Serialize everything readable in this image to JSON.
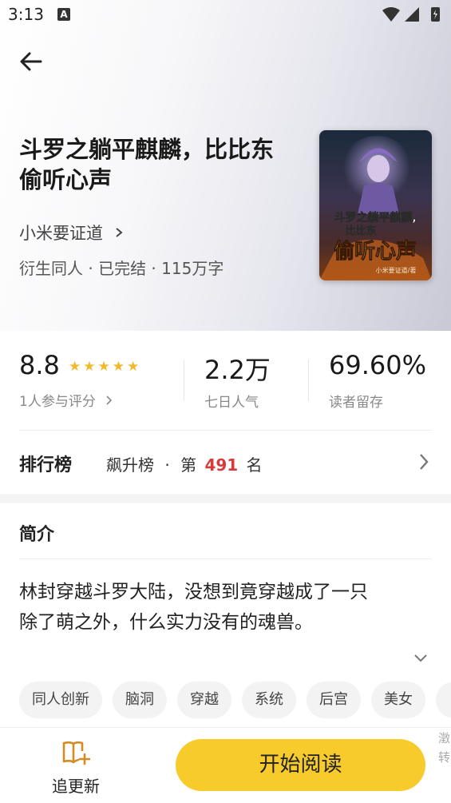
{
  "status_bar": {
    "time": "3:13",
    "notification_icon_letter": "A",
    "icons": [
      "wifi-icon",
      "signal-icon",
      "battery-icon"
    ]
  },
  "book": {
    "title_line1": "斗罗之躺平麒麟，比比东",
    "title_line2": "偷听心声",
    "author": "小米要证道",
    "meta": "衍生同人 · 已完结 · 115万字",
    "cover": {
      "line1": "斗罗之躺平麒麟,",
      "line2": "比比东",
      "line3": "偷听心声",
      "byline": "小米要证道/著"
    }
  },
  "stats": {
    "score": "8.8",
    "stars": "★★★★★",
    "rating_count_label": "1人参与评分",
    "popularity_value": "2.2万",
    "popularity_label": "七日人气",
    "retention_value": "69.60%",
    "retention_label": "读者留存"
  },
  "ranking": {
    "title": "排行榜",
    "list_name": "飙升榜",
    "separator": "·",
    "prefix": "第",
    "rank": "491",
    "suffix": "名"
  },
  "intro": {
    "title": "简介",
    "line1": "林封穿越斗罗大陆，没想到竟穿越成了一只",
    "line2": "除了萌之外，什么实力没有的魂兽。"
  },
  "tags": [
    "同人创新",
    "脑洞",
    "穿越",
    "系统",
    "后宫",
    "美女"
  ],
  "bottom_bar": {
    "follow_label": "追更新",
    "read_label": "开始阅读",
    "side_hint": "澂转"
  },
  "colors": {
    "accent_yellow": "#f7cb2c",
    "star": "#f2b92c",
    "rank_red": "#d93b3b"
  }
}
